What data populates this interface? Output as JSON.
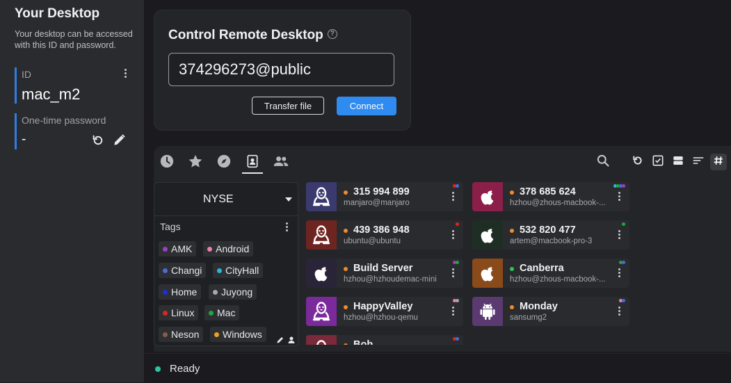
{
  "sidebar": {
    "title": "Your Desktop",
    "description": "Your desktop can be accessed with this ID and password.",
    "id_label": "ID",
    "id_value": "mac_m2",
    "password_label": "One-time password",
    "password_value": "-"
  },
  "control": {
    "title": "Control Remote Desktop",
    "id_input_value": "374296273@public",
    "transfer_label": "Transfer file",
    "connect_label": "Connect"
  },
  "tabs": [
    {
      "icon": "clock-icon",
      "name": "recent"
    },
    {
      "icon": "star-icon",
      "name": "favorites"
    },
    {
      "icon": "compass-icon",
      "name": "discovered"
    },
    {
      "icon": "address-book-icon",
      "name": "address-book",
      "active": true
    },
    {
      "icon": "group-icon",
      "name": "group"
    }
  ],
  "group": {
    "selected": "NYSE"
  },
  "tags_label": "Tags",
  "tags": [
    {
      "name": "AMK",
      "color": "#9b3fc4"
    },
    {
      "name": "Android",
      "color": "#e87fb0"
    },
    {
      "name": "Changi",
      "color": "#4a6bd8"
    },
    {
      "name": "CityHall",
      "color": "#27b8d8"
    },
    {
      "name": "Home",
      "color": "#1c2fe0"
    },
    {
      "name": "Juyong",
      "color": "#a8a8ac"
    },
    {
      "name": "Linux",
      "color": "#e02424"
    },
    {
      "name": "Mac",
      "color": "#1fa83a"
    },
    {
      "name": "Neson",
      "color": "#8a5a4a"
    },
    {
      "name": "Windows",
      "color": "#f0a020"
    }
  ],
  "peers": [
    {
      "id": "315 994 899",
      "user": "manjaro@manjaro",
      "os": "linux",
      "avatar_color": "#3b3a6e",
      "status_color": "#f08a2c",
      "tag_dots": [
        "#e02424",
        "#4a6bd8"
      ]
    },
    {
      "id": "378 685 624",
      "user": "hzhou@zhous-macbook-...",
      "os": "mac",
      "avatar_color": "#8c1f4a",
      "status_color": "#f08a2c",
      "tag_dots": [
        "#27b8d8",
        "#1fa83a",
        "#4a6bd8",
        "#9b3fc4"
      ]
    },
    {
      "id": "439 386 948",
      "user": "ubuntu@ubuntu",
      "os": "linux",
      "avatar_color": "#6e2420",
      "status_color": "#f08a2c",
      "tag_dots": [
        "#e02424"
      ]
    },
    {
      "id": "532 820 477",
      "user": "artem@macbook-pro-3",
      "os": "mac",
      "avatar_color": "#1f2e24",
      "status_color": "#f08a2c",
      "tag_dots": [
        "#1fa83a"
      ]
    },
    {
      "id": "Build Server",
      "user": "hzhou@hzhoudemac-mini",
      "os": "mac",
      "avatar_color": "#2a2438",
      "status_color": "#f08a2c",
      "tag_dots": [
        "#9b3fc4",
        "#1fa83a"
      ]
    },
    {
      "id": "Canberra",
      "user": "hzhou@zhous-macbook-...",
      "os": "mac",
      "avatar_color": "#8a4a1a",
      "status_color": "#2ec45a",
      "tag_dots": [
        "#1fa83a",
        "#4a6bd8"
      ]
    },
    {
      "id": "HappyValley",
      "user": "hzhou@hzhou-qemu",
      "os": "linux",
      "avatar_color": "#7a2a9a",
      "status_color": "#f08a2c",
      "tag_dots": [
        "#e87fb0",
        "#a8a8ac"
      ]
    },
    {
      "id": "Monday",
      "user": "sansumg2",
      "os": "android",
      "avatar_color": "#5a3a70",
      "status_color": "#f08a2c",
      "tag_dots": [
        "#e87fb0",
        "#4a6bd8"
      ]
    },
    {
      "id": "Bob",
      "user": "",
      "os": "linux",
      "avatar_color": "#7a2a3a",
      "status_color": "#f08a2c",
      "tag_dots": [
        "#e02424",
        "#4a6bd8"
      ]
    }
  ],
  "status": {
    "text": "Ready",
    "color": "#2ec4a2"
  }
}
